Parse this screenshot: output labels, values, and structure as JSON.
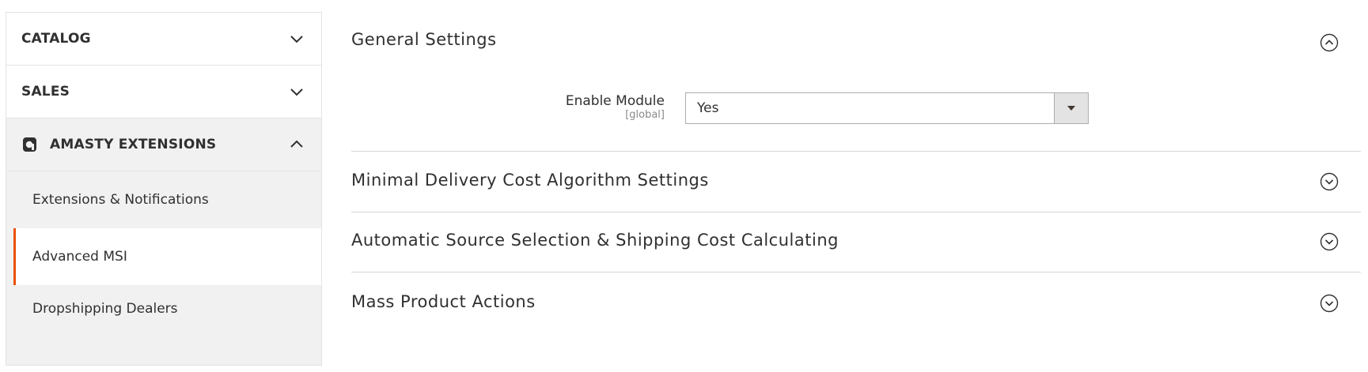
{
  "sidebar": {
    "sections": [
      {
        "label": "CATALOG",
        "icon": "chevron-down-icon"
      },
      {
        "label": "SALES",
        "icon": "chevron-down-icon"
      },
      {
        "label": "AMASTY EXTENSIONS",
        "icon": "chevron-up-icon",
        "logo": "amasty-logo-icon"
      }
    ],
    "items": [
      {
        "label": "Extensions & Notifications"
      },
      {
        "label": "Advanced MSI",
        "active": true
      },
      {
        "label": "Dropshipping Dealers"
      }
    ]
  },
  "main": {
    "groups": [
      {
        "title": "General Settings",
        "state": "expanded",
        "icon": "circle-chevron-up-icon"
      },
      {
        "title": "Minimal Delivery Cost Algorithm Settings",
        "state": "collapsed",
        "icon": "circle-chevron-down-icon"
      },
      {
        "title": "Automatic Source Selection & Shipping Cost Calculating",
        "state": "collapsed",
        "icon": "circle-chevron-down-icon"
      },
      {
        "title": "Mass Product Actions",
        "state": "collapsed",
        "icon": "circle-chevron-down-icon"
      }
    ],
    "fields": {
      "enable_module": {
        "label": "Enable Module",
        "scope": "[global]",
        "value": "Yes"
      }
    }
  },
  "colors": {
    "accent": "#eb5202",
    "sidebar_bg": "#f1f1f1",
    "text": "#303030",
    "divider": "#d6d6d6"
  }
}
